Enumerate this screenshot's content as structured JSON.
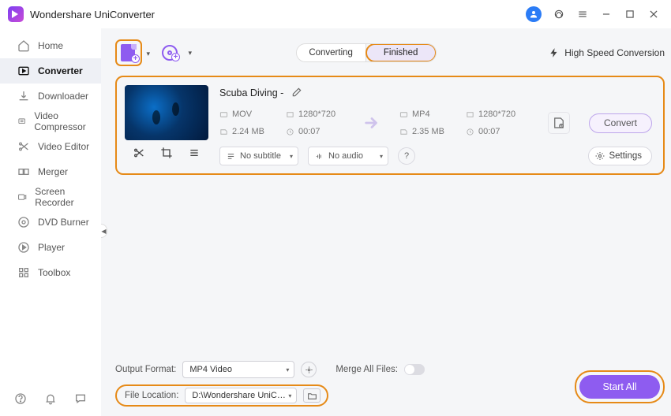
{
  "app": {
    "name": "Wondershare UniConverter"
  },
  "sidebar": {
    "items": [
      {
        "label": "Home"
      },
      {
        "label": "Converter"
      },
      {
        "label": "Downloader"
      },
      {
        "label": "Video Compressor"
      },
      {
        "label": "Video Editor"
      },
      {
        "label": "Merger"
      },
      {
        "label": "Screen Recorder"
      },
      {
        "label": "DVD Burner"
      },
      {
        "label": "Player"
      },
      {
        "label": "Toolbox"
      }
    ]
  },
  "toolbar": {
    "tabs": {
      "converting": "Converting",
      "finished": "Finished"
    },
    "high_speed": "High Speed Conversion"
  },
  "item": {
    "title": "Scuba Diving  -",
    "source": {
      "format": "MOV",
      "resolution": "1280*720",
      "size": "2.24 MB",
      "duration": "00:07"
    },
    "target": {
      "format": "MP4",
      "resolution": "1280*720",
      "size": "2.35 MB",
      "duration": "00:07"
    },
    "subtitle": "No subtitle",
    "audio": "No audio",
    "settings_label": "Settings",
    "convert_label": "Convert"
  },
  "footer": {
    "output_format_label": "Output Format:",
    "output_format_value": "MP4 Video",
    "merge_label": "Merge All Files:",
    "file_location_label": "File Location:",
    "file_location_value": "D:\\Wondershare UniConverter",
    "start_all": "Start All"
  }
}
